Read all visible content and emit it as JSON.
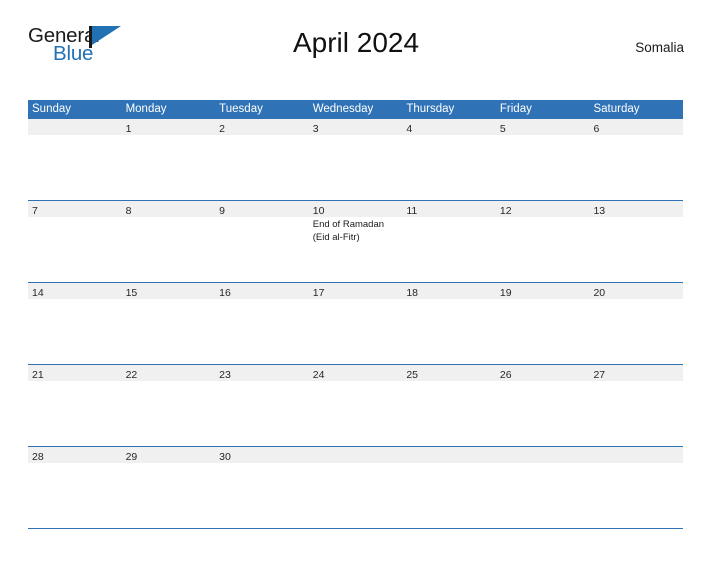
{
  "brand": {
    "name_part1": "General",
    "name_part2": "Blue",
    "flag_icon": "flag-triangle-icon"
  },
  "header": {
    "title": "April 2024",
    "region": "Somalia"
  },
  "calendar": {
    "month": "April",
    "year": "2024",
    "weekday_headers": [
      "Sunday",
      "Monday",
      "Tuesday",
      "Wednesday",
      "Thursday",
      "Friday",
      "Saturday"
    ],
    "colors": {
      "header_blue": "#2f72b5",
      "number_strip_gray": "#f0f0f0",
      "brand_blue": "#2271b5",
      "text_dark": "#1a1a1a"
    },
    "weeks": [
      [
        {
          "day": "",
          "events": []
        },
        {
          "day": "1",
          "events": []
        },
        {
          "day": "2",
          "events": []
        },
        {
          "day": "3",
          "events": []
        },
        {
          "day": "4",
          "events": []
        },
        {
          "day": "5",
          "events": []
        },
        {
          "day": "6",
          "events": []
        }
      ],
      [
        {
          "day": "7",
          "events": []
        },
        {
          "day": "8",
          "events": []
        },
        {
          "day": "9",
          "events": []
        },
        {
          "day": "10",
          "events": [
            "End of Ramadan",
            "(Eid al-Fitr)"
          ]
        },
        {
          "day": "11",
          "events": []
        },
        {
          "day": "12",
          "events": []
        },
        {
          "day": "13",
          "events": []
        }
      ],
      [
        {
          "day": "14",
          "events": []
        },
        {
          "day": "15",
          "events": []
        },
        {
          "day": "16",
          "events": []
        },
        {
          "day": "17",
          "events": []
        },
        {
          "day": "18",
          "events": []
        },
        {
          "day": "19",
          "events": []
        },
        {
          "day": "20",
          "events": []
        }
      ],
      [
        {
          "day": "21",
          "events": []
        },
        {
          "day": "22",
          "events": []
        },
        {
          "day": "23",
          "events": []
        },
        {
          "day": "24",
          "events": []
        },
        {
          "day": "25",
          "events": []
        },
        {
          "day": "26",
          "events": []
        },
        {
          "day": "27",
          "events": []
        }
      ],
      [
        {
          "day": "28",
          "events": []
        },
        {
          "day": "29",
          "events": []
        },
        {
          "day": "30",
          "events": []
        },
        {
          "day": "",
          "events": []
        },
        {
          "day": "",
          "events": []
        },
        {
          "day": "",
          "events": []
        },
        {
          "day": "",
          "events": []
        }
      ]
    ]
  }
}
